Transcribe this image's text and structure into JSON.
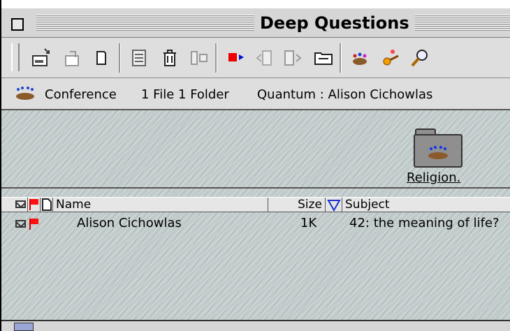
{
  "window": {
    "title": "Deep Questions"
  },
  "toolbar": {
    "icons": [
      "new-message-icon",
      "reply-icon",
      "new-document-icon",
      "preferences-icon",
      "trash-icon",
      "filter-icon",
      "flag-icon",
      "previous-icon",
      "next-icon",
      "folder-icon",
      "conference-add-icon",
      "key-icon",
      "search-icon"
    ]
  },
  "pathbar": {
    "label": "Conference",
    "counts": "1 File 1 Folder",
    "location": "Quantum : Alison Cichowlas"
  },
  "iconpane": {
    "folder_label": "Religion."
  },
  "list": {
    "columns": {
      "name": "Name",
      "size": "Size",
      "subject": "Subject"
    },
    "rows": [
      {
        "name": "Alison Cichowlas",
        "size": "1K",
        "subject": "42: the meaning of life?"
      }
    ]
  },
  "colors": {
    "flag": "#ff1010",
    "texture": "#c2cbcb",
    "scroll_thumb": "#9aa6d8"
  }
}
